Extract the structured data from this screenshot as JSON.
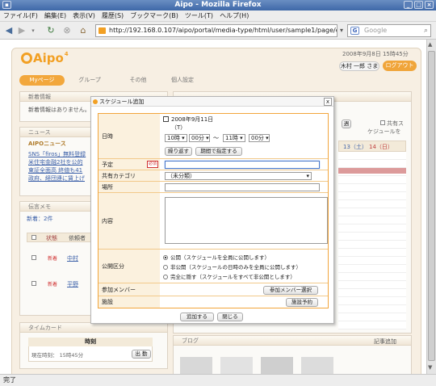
{
  "window": {
    "title": "Aipo - Mozilla Firefox"
  },
  "menu": [
    "ファイル(F)",
    "編集(E)",
    "表示(V)",
    "履歴(S)",
    "ブックマーク(B)",
    "ツール(T)",
    "ヘルプ(H)"
  ],
  "nav": {
    "url": "http://192.168.0.107/aipo/portal/media-type/html/user/sample1/page/de",
    "search_placeholder": "Google"
  },
  "status": "完了",
  "app": {
    "logo": "Aipo",
    "date_time": "2008年9月8日 15時45分",
    "user": "木村 一郎 さま",
    "logout": "ログアウト",
    "tabs": [
      "Myページ",
      "グループ",
      "その他",
      "個人設定"
    ]
  },
  "portlets": {
    "news_info": {
      "title": "新着情報",
      "body": "新着情報はありません。"
    },
    "news": {
      "title": "ニュース",
      "source": "AIPOニュース",
      "items": [
        "SNS「firos」無料登録",
        "米住宅金融2社を公的",
        "東証全面高 終値も41",
        "政府、経団連に賃上げ"
      ]
    },
    "memo": {
      "title": "伝言メモ",
      "count": "新着：2件",
      "headers": [
        "状態",
        "依頼者"
      ],
      "rows": [
        {
          "state": "新着",
          "from": "中村"
        },
        {
          "state": "新着",
          "from": "平野"
        }
      ]
    },
    "timecard": {
      "title": "タイムカード",
      "col": "時刻",
      "now": "現在時刻： 15時45分",
      "button": "出 勤"
    },
    "blog": {
      "title": "ブログ",
      "link": "記事追加"
    },
    "schedule": {
      "public_label": "共有ス",
      "public_label2": "ケジュールを",
      "days": [
        "13（土）",
        "14（日）"
      ],
      "btn": "週"
    }
  },
  "modal": {
    "title": "スケジュール追加",
    "labels": {
      "datetime": "日時",
      "title": "予定",
      "category": "共有カテゴリ",
      "place": "場所",
      "content": "内容",
      "public": "公開区分",
      "members": "参加メンバー",
      "facility": "施設"
    },
    "date": "2008年9月11日",
    "weekday": "（T）",
    "start_hour": "10時",
    "start_min": "00分",
    "tilde": "～",
    "end_hour": "11時",
    "end_min": "00分",
    "repeat_button": "繰り返す",
    "period_button": "期間で指定する",
    "required_mark": "必須",
    "category_value": "（未分類）",
    "public_options": [
      "公開（スケジュールを全員に公開します）",
      "非公開（スケジュールの日時のみを全員に公開します）",
      "完全に隠す（スケジュールをすべて非公開とします）"
    ],
    "member_button": "参加メンバー選択",
    "facility_button": "施設予約",
    "add_button": "追加する",
    "close_button": "閉じる",
    "close_x": "x"
  }
}
